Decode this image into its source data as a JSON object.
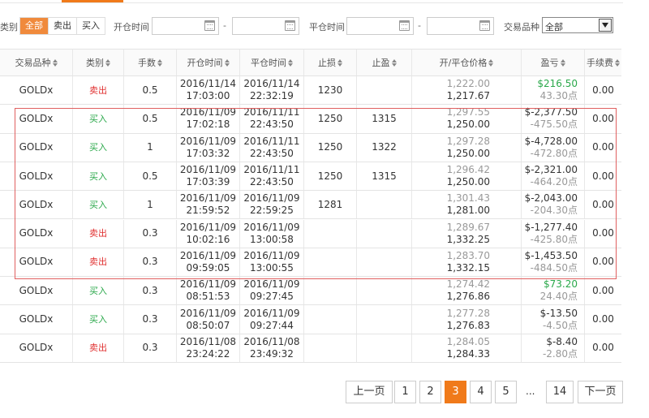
{
  "filter": {
    "type_label": "类别",
    "type_options": [
      "全部",
      "卖出",
      "买入"
    ],
    "open_time_label": "开仓时间",
    "close_time_label": "平仓时间",
    "range_sep": "-",
    "product_label": "交易品种",
    "product_value": "全部"
  },
  "columns": [
    "交易品种",
    "类别",
    "手数",
    "开仓时间",
    "平仓时间",
    "止损",
    "止盈",
    "开/平仓价格",
    "盈亏",
    "手续费"
  ],
  "rows": [
    {
      "product": "GOLDx",
      "side": "卖出",
      "lots": "0.5",
      "open_date": "2016/11/14",
      "open_time": "17:03:00",
      "close_date": "2016/11/14",
      "close_time": "22:32:19",
      "sl": "1230",
      "tp": "",
      "open_price": "1,222.00",
      "close_price": "1,217.67",
      "pnl": "$216.50",
      "pnl_pts": "43.30点",
      "fee": "0.00"
    },
    {
      "product": "GOLDx",
      "side": "买入",
      "lots": "0.5",
      "open_date": "2016/11/09",
      "open_time": "17:02:18",
      "close_date": "2016/11/11",
      "close_time": "22:43:50",
      "sl": "1250",
      "tp": "1315",
      "open_price": "1,297.55",
      "close_price": "1,250.00",
      "pnl": "$-2,377.50",
      "pnl_pts": "-475.50点",
      "fee": "0.00"
    },
    {
      "product": "GOLDx",
      "side": "买入",
      "lots": "1",
      "open_date": "2016/11/09",
      "open_time": "17:03:32",
      "close_date": "2016/11/11",
      "close_time": "22:43:50",
      "sl": "1250",
      "tp": "1322",
      "open_price": "1,297.28",
      "close_price": "1,250.00",
      "pnl": "$-4,728.00",
      "pnl_pts": "-472.80点",
      "fee": "0.00"
    },
    {
      "product": "GOLDx",
      "side": "买入",
      "lots": "0.5",
      "open_date": "2016/11/09",
      "open_time": "17:03:39",
      "close_date": "2016/11/11",
      "close_time": "22:43:50",
      "sl": "1250",
      "tp": "1315",
      "open_price": "1,296.42",
      "close_price": "1,250.00",
      "pnl": "$-2,321.00",
      "pnl_pts": "-464.20点",
      "fee": "0.00"
    },
    {
      "product": "GOLDx",
      "side": "买入",
      "lots": "1",
      "open_date": "2016/11/09",
      "open_time": "21:59:52",
      "close_date": "2016/11/09",
      "close_time": "22:59:25",
      "sl": "1281",
      "tp": "",
      "open_price": "1,301.43",
      "close_price": "1,281.00",
      "pnl": "$-2,043.00",
      "pnl_pts": "-204.30点",
      "fee": "0.00"
    },
    {
      "product": "GOLDx",
      "side": "卖出",
      "lots": "0.3",
      "open_date": "2016/11/09",
      "open_time": "10:02:16",
      "close_date": "2016/11/09",
      "close_time": "13:00:58",
      "sl": "",
      "tp": "",
      "open_price": "1,289.67",
      "close_price": "1,332.25",
      "pnl": "$-1,277.40",
      "pnl_pts": "-425.80点",
      "fee": "0.00"
    },
    {
      "product": "GOLDx",
      "side": "卖出",
      "lots": "0.3",
      "open_date": "2016/11/09",
      "open_time": "09:59:05",
      "close_date": "2016/11/09",
      "close_time": "13:00:55",
      "sl": "",
      "tp": "",
      "open_price": "1,283.70",
      "close_price": "1,332.15",
      "pnl": "$-1,453.50",
      "pnl_pts": "-484.50点",
      "fee": "0.00"
    },
    {
      "product": "GOLDx",
      "side": "买入",
      "lots": "0.3",
      "open_date": "2016/11/09",
      "open_time": "08:51:53",
      "close_date": "2016/11/09",
      "close_time": "09:27:45",
      "sl": "",
      "tp": "",
      "open_price": "1,274.42",
      "close_price": "1,276.86",
      "pnl": "$73.20",
      "pnl_pts": "24.40点",
      "fee": "0.00"
    },
    {
      "product": "GOLDx",
      "side": "买入",
      "lots": "0.3",
      "open_date": "2016/11/09",
      "open_time": "08:50:07",
      "close_date": "2016/11/09",
      "close_time": "09:27:44",
      "sl": "",
      "tp": "",
      "open_price": "1,277.28",
      "close_price": "1,276.83",
      "pnl": "$-13.50",
      "pnl_pts": "-4.50点",
      "fee": "0.00"
    },
    {
      "product": "GOLDx",
      "side": "卖出",
      "lots": "0.3",
      "open_date": "2016/11/08",
      "open_time": "23:24:22",
      "close_date": "2016/11/08",
      "close_time": "23:49:32",
      "sl": "",
      "tp": "",
      "open_price": "1,284.05",
      "close_price": "1,284.33",
      "pnl": "$-8.40",
      "pnl_pts": "-2.80点",
      "fee": "0.00"
    }
  ],
  "pagination": {
    "prev": "上一页",
    "next": "下一页",
    "pages": [
      "1",
      "2",
      "3",
      "4",
      "5"
    ],
    "dots": "...",
    "last": "14",
    "current": "3"
  },
  "colors": {
    "accent": "#f07a1a",
    "sell": "#e03030",
    "buy": "#2aa84a",
    "highlight": "#e06060"
  }
}
